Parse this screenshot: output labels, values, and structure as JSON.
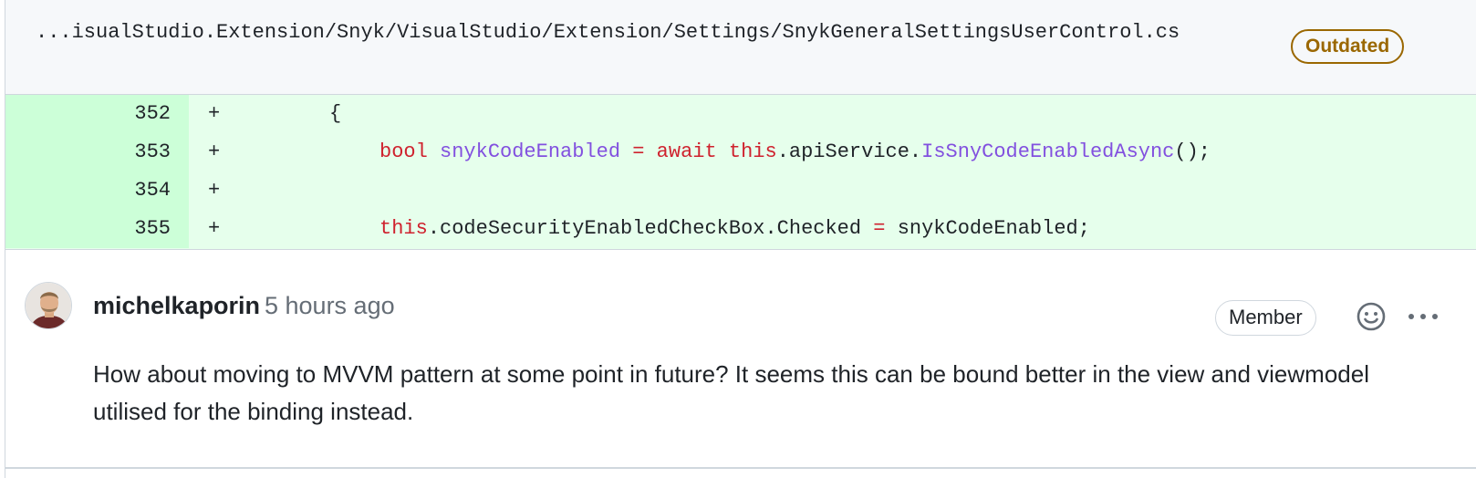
{
  "file": {
    "path": "...isualStudio.Extension/Snyk/VisualStudio/Extension/Settings/SnykGeneralSettingsUserControl.cs",
    "badge": "Outdated",
    "badge_color": "#9a6700"
  },
  "diff": {
    "added_bg": "#e6ffec",
    "gutter_bg": "#ccffd8",
    "lines": [
      {
        "number": "352",
        "marker": "+",
        "tokens": [
          "{"
        ]
      },
      {
        "number": "353",
        "marker": "+",
        "tokens": [
          "bool",
          " ",
          "snykCodeEnabled",
          " ",
          "=",
          " ",
          "await",
          " ",
          "this",
          ".apiService.",
          "IsSnyCodeEnabledAsync",
          "();"
        ]
      },
      {
        "number": "354",
        "marker": "+",
        "tokens": []
      },
      {
        "number": "355",
        "marker": "+",
        "tokens": [
          "this",
          ".codeSecurityEnabledCheckBox.Checked ",
          "=",
          " snykCodeEnabled;"
        ]
      }
    ]
  },
  "comment": {
    "author": "michelkaporin",
    "timestamp": "5 hours ago",
    "role_badge": "Member",
    "reaction_icon": "smiley-icon",
    "menu_icon": "kebab-horizontal-icon",
    "body": "How about moving to MVVM pattern at some point in future? It seems this can be bound better in the view and viewmodel utilised for the binding instead."
  }
}
